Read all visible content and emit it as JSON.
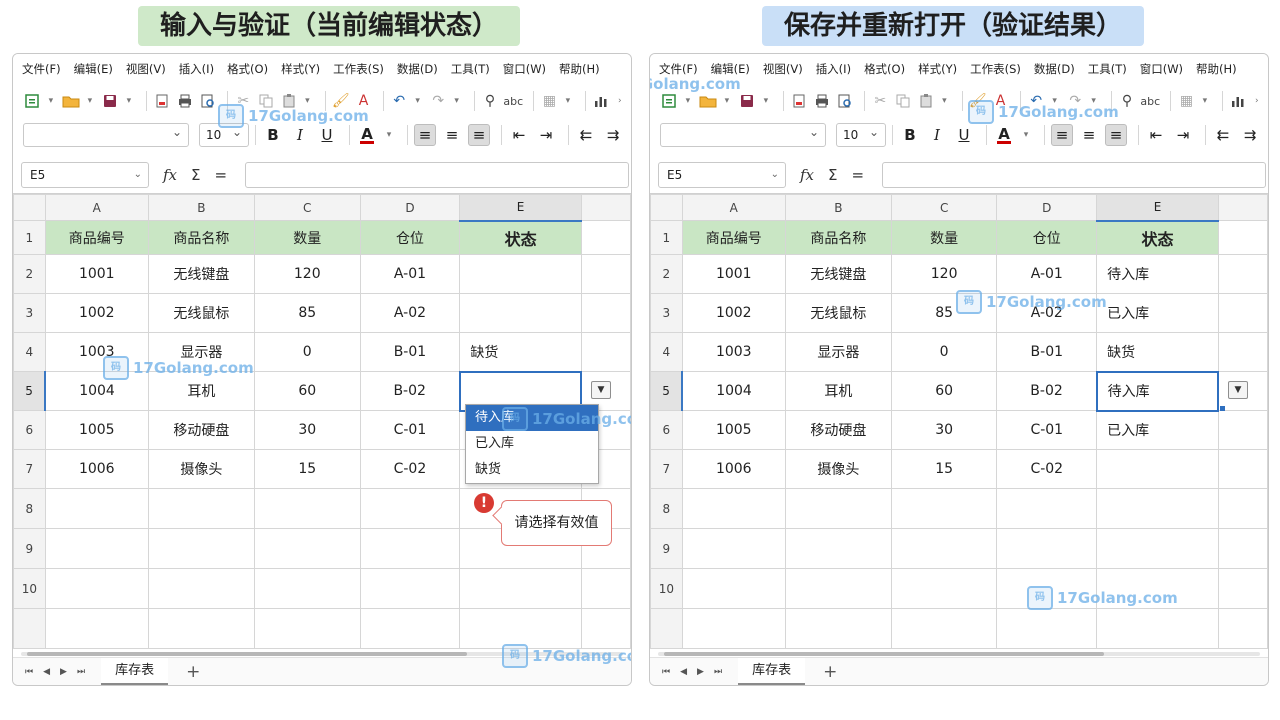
{
  "labels": {
    "left": "输入与验证（当前编辑状态）",
    "right": "保存并重新打开（验证结果）"
  },
  "menu": [
    "文件(F)",
    "编辑(E)",
    "视图(V)",
    "插入(I)",
    "格式(O)",
    "样式(Y)",
    "工作表(S)",
    "数据(D)",
    "工具(T)",
    "窗口(W)",
    "帮助(H)"
  ],
  "font_size": "10",
  "name_box": "E5",
  "formula_symbols": {
    "fx": "fx",
    "sum": "Σ",
    "equals": "="
  },
  "format_buttons": {
    "bold": "B",
    "italic": "I",
    "underline": "U",
    "font_color": "A"
  },
  "columns": [
    "A",
    "B",
    "C",
    "D",
    "E"
  ],
  "rows": [
    "1",
    "2",
    "3",
    "4",
    "5",
    "6",
    "7",
    "8",
    "9",
    "10"
  ],
  "table_headers": [
    "商品编号",
    "商品名称",
    "数量",
    "仓位",
    "状态"
  ],
  "data_rows": [
    [
      "1001",
      "无线键盘",
      "120",
      "A-01"
    ],
    [
      "1002",
      "无线鼠标",
      "85",
      "A-02"
    ],
    [
      "1003",
      "显示器",
      "0",
      "B-01"
    ],
    [
      "1004",
      "耳机",
      "60",
      "B-02"
    ],
    [
      "1005",
      "移动硬盘",
      "30",
      "C-01"
    ],
    [
      "1006",
      "摄像头",
      "15",
      "C-02"
    ]
  ],
  "left_status": [
    "",
    "",
    "缺货",
    "",
    "",
    ""
  ],
  "right_status": [
    "待入库",
    "已入库",
    "缺货",
    "待入库",
    "已入库",
    ""
  ],
  "dropdown_options": [
    "待入库",
    "已入库",
    "缺货"
  ],
  "dropdown_highlight": "待入库",
  "error_tooltip": "请选择有效值",
  "error_icon": "!",
  "sheet_tab": "库存表",
  "add_sheet": "+",
  "watermark": "17Golang.com",
  "icons": [
    "new-doc-icon",
    "open-folder-icon",
    "save-icon",
    "pdf-icon",
    "print-icon",
    "preview-icon",
    "cut-icon",
    "copy-icon",
    "paste-icon",
    "brush-icon",
    "clear-format-icon",
    "undo-icon",
    "redo-icon",
    "find-icon",
    "spell-check-icon",
    "borders-icon",
    "chart-icon"
  ],
  "colors": {
    "header_fill": "#c9e6c4",
    "selection": "#2f6fbf",
    "left_label_bg": "#cfe9c9",
    "right_label_bg": "#c9dff7",
    "error": "#d83a32"
  }
}
